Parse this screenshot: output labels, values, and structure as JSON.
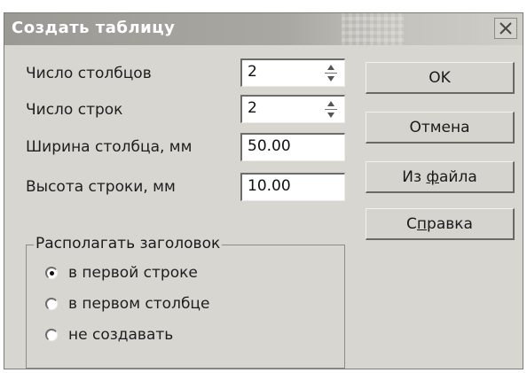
{
  "dialog": {
    "title": "Создать таблицу",
    "close_label": "×"
  },
  "fields": {
    "columns": {
      "label": "Число столбцов",
      "value": "2"
    },
    "rows": {
      "label": "Число строк",
      "value": "2"
    },
    "col_width": {
      "label": "Ширина столбца, мм",
      "value": "50.00"
    },
    "row_height": {
      "label": "Высота строки, мм",
      "value": "10.00"
    }
  },
  "buttons": {
    "ok": "OK",
    "cancel": "Отмена",
    "from_file_pre": "Из ",
    "from_file_u": "ф",
    "from_file_post": "айла",
    "help_pre": "С",
    "help_u": "п",
    "help_post": "равка"
  },
  "header_group": {
    "title": "Располагать заголовок",
    "options": [
      {
        "label": "в первой строке",
        "checked": true
      },
      {
        "label": "в первом столбце",
        "checked": false
      },
      {
        "label": "не создавать",
        "checked": false
      }
    ]
  },
  "icons": {
    "close": "close-icon",
    "spin_up": "spin-up-icon",
    "spin_down": "spin-down-icon"
  },
  "colors": {
    "dialog_bg": "#d8d6d0",
    "titlebar": "#a9a8a2",
    "title_text": "#ffffff"
  }
}
